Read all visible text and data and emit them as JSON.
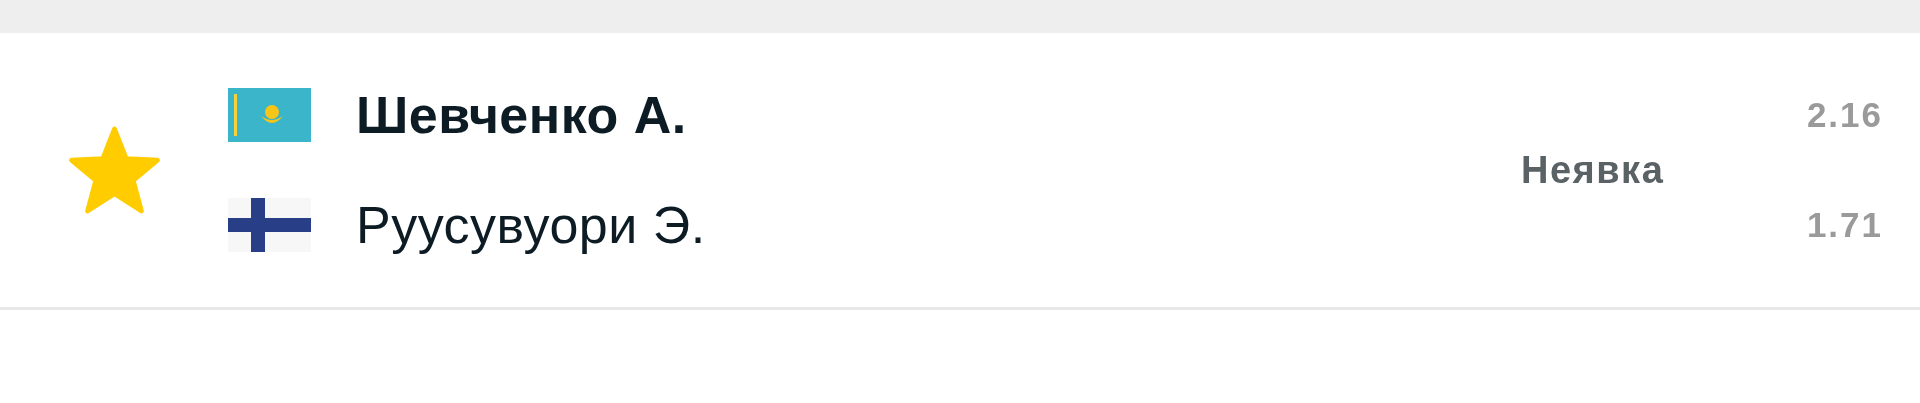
{
  "match": {
    "favorite": true,
    "players": [
      {
        "flag": {
          "kind": "kz"
        },
        "name": "Шевченко А.",
        "winner": true,
        "odds": "2.16"
      },
      {
        "flag": {
          "kind": "fi"
        },
        "name": "Руусувуори Э.",
        "winner": false,
        "odds": "1.71"
      }
    ],
    "status": "Неявка"
  }
}
